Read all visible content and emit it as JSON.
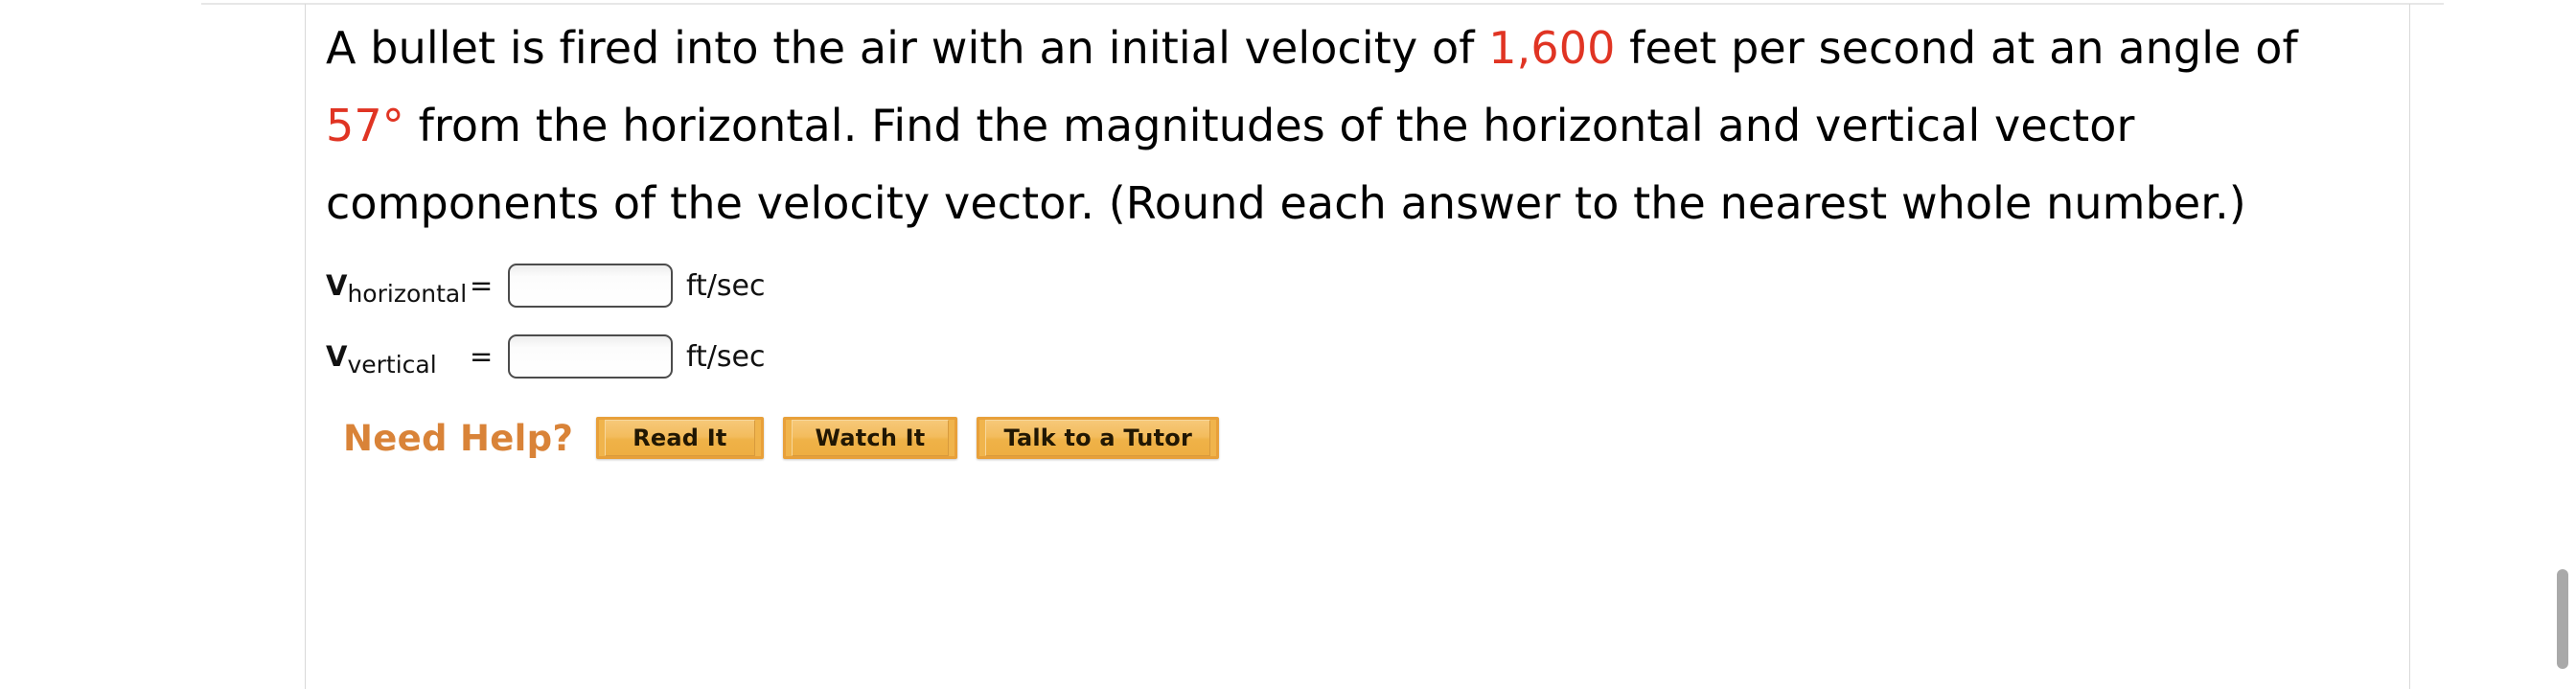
{
  "question": {
    "text_segments": [
      {
        "t": "A bullet is fired into the air with an initial velocity of ",
        "hl": false
      },
      {
        "t": "1,600",
        "hl": true
      },
      {
        "t": " feet per second at an angle of ",
        "hl": false
      },
      {
        "t": "57°",
        "hl": true
      },
      {
        "t": " from the horizontal. Find the magnitudes of the horizontal and vertical vector components of the velocity vector. (Round each answer to the nearest whole number.)",
        "hl": false
      }
    ],
    "plain_text": "A bullet is fired into the air with an initial velocity of 1,600 feet per second at an angle of 57° from the horizontal. Find the magnitudes of the horizontal and vertical vector components of the velocity vector. (Round each answer to the nearest whole number.)",
    "highlight_color": "#e03423",
    "highlighted_values": [
      "1,600",
      "57°"
    ]
  },
  "answers": [
    {
      "symbol": "V",
      "subscript": "horizontal",
      "equals": "=",
      "value": "",
      "placeholder": "",
      "unit": "ft/sec"
    },
    {
      "symbol": "V",
      "subscript": "vertical",
      "equals": "=",
      "value": "",
      "placeholder": "",
      "unit": "ft/sec"
    }
  ],
  "help": {
    "label": "Need Help?",
    "label_color": "#d98338",
    "buttons": [
      {
        "label": "Read It"
      },
      {
        "label": "Watch It"
      },
      {
        "label": "Talk to a Tutor"
      }
    ],
    "button_fill": "#f0b44c",
    "button_border": "#e8a03a"
  },
  "scrollbar": {
    "thumb_color": "#a9a9a9"
  }
}
